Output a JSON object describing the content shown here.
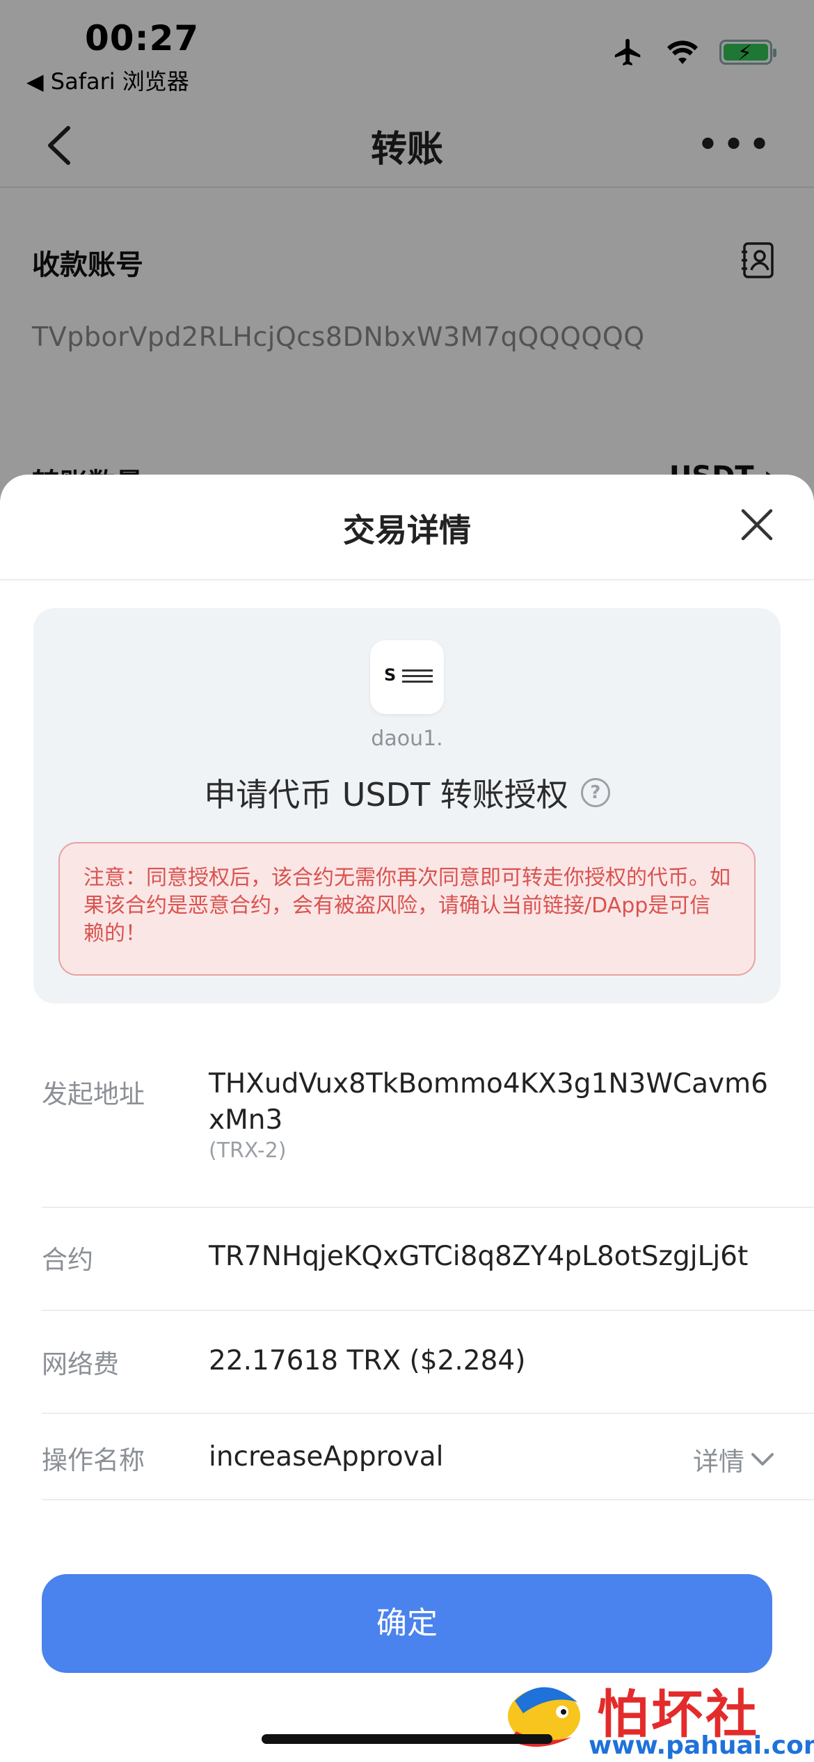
{
  "status_bar": {
    "time": "00:27",
    "back_app": "◀ Safari 浏览器"
  },
  "nav": {
    "title": "转账"
  },
  "under": {
    "receive_label": "收款账号",
    "receive_address": "TVpborVpd2RLHcjQcs8DNbxW3M7qQQQQQQ",
    "amount_label": "转账数量",
    "token": "USDT ›"
  },
  "sheet": {
    "title": "交易详情",
    "dapp_domain": "daou1.",
    "auth_title": "申请代币 USDT 转账授权",
    "help_glyph": "?",
    "warning": "注意：同意授权后，该合约无需你再次同意即可转走你授权的代币。如果该合约是恶意合约，会有被盗风险，请确认当前链接/DApp是可信赖的！",
    "rows": [
      {
        "label": "发起地址",
        "value": "THXudVux8TkBommo4KX3g1N3WCavm6xMn3",
        "sub": "(TRX-2)"
      },
      {
        "label": "合约",
        "value": "TR7NHqjeKQxGTCi8q8ZY4pL8otSzgjLj6t"
      },
      {
        "label": "网络费",
        "value": "22.17618 TRX ($2.284)"
      },
      {
        "label": "操作名称",
        "value": "increaseApproval",
        "link": "详情"
      }
    ],
    "confirm_label": "确定"
  },
  "watermark": {
    "text": "怕坏社区",
    "url": "www.pahuai.com"
  },
  "colors": {
    "accent": "#4a82ee",
    "warning_text": "#d9534f",
    "warning_bg": "#fbe6e6",
    "battery": "#34c759"
  }
}
